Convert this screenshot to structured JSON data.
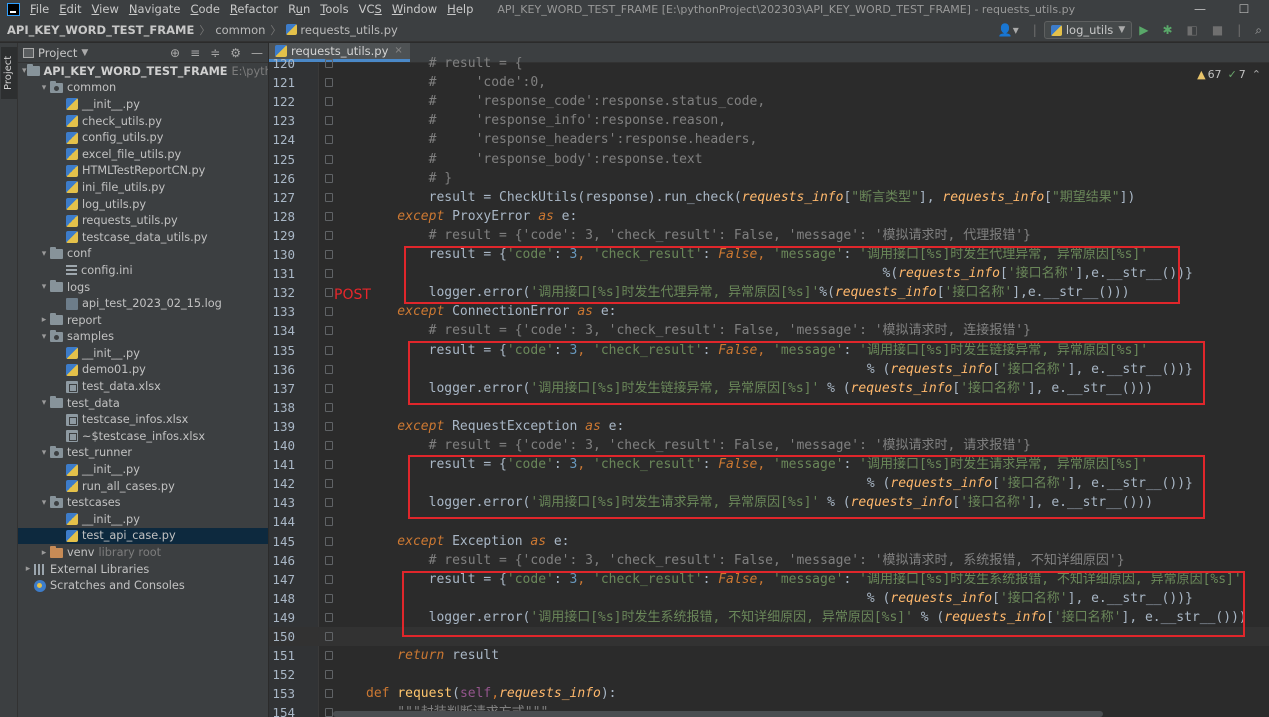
{
  "menu": {
    "items": [
      {
        "pre": "",
        "u": "F",
        "post": "ile"
      },
      {
        "pre": "",
        "u": "E",
        "post": "dit"
      },
      {
        "pre": "",
        "u": "V",
        "post": "iew"
      },
      {
        "pre": "",
        "u": "N",
        "post": "avigate"
      },
      {
        "pre": "",
        "u": "C",
        "post": "ode"
      },
      {
        "pre": "",
        "u": "R",
        "post": "efactor"
      },
      {
        "pre": "R",
        "u": "u",
        "post": "n"
      },
      {
        "pre": "",
        "u": "T",
        "post": "ools"
      },
      {
        "pre": "VC",
        "u": "S",
        "post": ""
      },
      {
        "pre": "",
        "u": "W",
        "post": "indow"
      },
      {
        "pre": "",
        "u": "H",
        "post": "elp"
      }
    ],
    "window_title": "API_KEY_WORD_TEST_FRAME [E:\\pythonProject\\202303\\API_KEY_WORD_TEST_FRAME] - requests_utils.py",
    "minimize": "—",
    "maximize": "☐"
  },
  "breadcrumb": {
    "project": "API_KEY_WORD_TEST_FRAME",
    "folder": "common",
    "file": "requests_utils.py"
  },
  "toolbar": {
    "user_icon": "person-icon",
    "run_config": "log_utils",
    "run": "▶",
    "debug": "✱",
    "coverage": "◧",
    "stop": "■",
    "search": "⌕"
  },
  "tool_strip": {
    "project_tab": "Project"
  },
  "project_panel": {
    "title": "Project",
    "tools": [
      "⊕",
      "≡",
      "≑",
      "⚙",
      "—"
    ],
    "tree": [
      {
        "depth": 0,
        "arrow": "▾",
        "icon": "folder",
        "label": "API_KEY_WORD_TEST_FRAME",
        "hint": "E:\\pythonPro",
        "bold": true
      },
      {
        "depth": 1,
        "arrow": "▾",
        "icon": "folder pkg",
        "label": "common"
      },
      {
        "depth": 2,
        "arrow": "",
        "icon": "py",
        "label": "__init__.py"
      },
      {
        "depth": 2,
        "arrow": "",
        "icon": "py",
        "label": "check_utils.py"
      },
      {
        "depth": 2,
        "arrow": "",
        "icon": "py",
        "label": "config_utils.py"
      },
      {
        "depth": 2,
        "arrow": "",
        "icon": "py",
        "label": "excel_file_utils.py"
      },
      {
        "depth": 2,
        "arrow": "",
        "icon": "py",
        "label": "HTMLTestReportCN.py"
      },
      {
        "depth": 2,
        "arrow": "",
        "icon": "py",
        "label": "ini_file_utils.py"
      },
      {
        "depth": 2,
        "arrow": "",
        "icon": "py",
        "label": "log_utils.py"
      },
      {
        "depth": 2,
        "arrow": "",
        "icon": "py",
        "label": "requests_utils.py"
      },
      {
        "depth": 2,
        "arrow": "",
        "icon": "py",
        "label": "testcase_data_utils.py"
      },
      {
        "depth": 1,
        "arrow": "▾",
        "icon": "folder",
        "label": "conf"
      },
      {
        "depth": 2,
        "arrow": "",
        "icon": "ini",
        "label": "config.ini"
      },
      {
        "depth": 1,
        "arrow": "▾",
        "icon": "folder",
        "label": "logs"
      },
      {
        "depth": 2,
        "arrow": "",
        "icon": "log",
        "label": "api_test_2023_02_15.log"
      },
      {
        "depth": 1,
        "arrow": "▸",
        "icon": "folder",
        "label": "report"
      },
      {
        "depth": 1,
        "arrow": "▾",
        "icon": "folder pkg",
        "label": "samples"
      },
      {
        "depth": 2,
        "arrow": "",
        "icon": "py",
        "label": "__init__.py"
      },
      {
        "depth": 2,
        "arrow": "",
        "icon": "py",
        "label": "demo01.py"
      },
      {
        "depth": 2,
        "arrow": "",
        "icon": "xlsx",
        "label": "test_data.xlsx"
      },
      {
        "depth": 1,
        "arrow": "▾",
        "icon": "folder",
        "label": "test_data"
      },
      {
        "depth": 2,
        "arrow": "",
        "icon": "xlsx",
        "label": "testcase_infos.xlsx"
      },
      {
        "depth": 2,
        "arrow": "",
        "icon": "xlsx",
        "label": "~$testcase_infos.xlsx"
      },
      {
        "depth": 1,
        "arrow": "▾",
        "icon": "folder pkg",
        "label": "test_runner"
      },
      {
        "depth": 2,
        "arrow": "",
        "icon": "py",
        "label": "__init__.py"
      },
      {
        "depth": 2,
        "arrow": "",
        "icon": "py",
        "label": "run_all_cases.py"
      },
      {
        "depth": 1,
        "arrow": "▾",
        "icon": "folder pkg",
        "label": "testcases"
      },
      {
        "depth": 2,
        "arrow": "",
        "icon": "py",
        "label": "__init__.py"
      },
      {
        "depth": 2,
        "arrow": "",
        "icon": "py",
        "label": "test_api_case.py",
        "selected": true
      },
      {
        "depth": 1,
        "arrow": "▸",
        "icon": "folder excluded",
        "label": "venv",
        "hint": "library root"
      },
      {
        "depth": 0,
        "arrow": "▸",
        "icon": "lib",
        "label": "External Libraries"
      },
      {
        "depth": 0,
        "arrow": "",
        "icon": "scratch",
        "label": "Scratches and Consoles"
      }
    ]
  },
  "editor": {
    "tab_label": "requests_utils.py",
    "tab_close": "×",
    "inspections": {
      "warnings": "67",
      "weak_warnings": "7"
    },
    "annotation": "POST",
    "current_line": 150
  },
  "code_lines": [
    {
      "n": "120",
      "parts": [
        [
          "cm",
          "        # result = {"
        ]
      ]
    },
    {
      "n": "121",
      "parts": [
        [
          "cm",
          "        #     'code':0,"
        ]
      ]
    },
    {
      "n": "122",
      "parts": [
        [
          "cm",
          "        #     'response_code':response.status_code,"
        ]
      ]
    },
    {
      "n": "123",
      "parts": [
        [
          "cm",
          "        #     'response_info':response.reason,"
        ]
      ]
    },
    {
      "n": "124",
      "parts": [
        [
          "cm",
          "        #     'response_headers':response.headers,"
        ]
      ]
    },
    {
      "n": "125",
      "parts": [
        [
          "cm",
          "        #     'response_body':response.text"
        ]
      ]
    },
    {
      "n": "126",
      "parts": [
        [
          "cm",
          "        # }"
        ]
      ]
    },
    {
      "n": "127",
      "parts": [
        [
          "",
          "        result = CheckUtils(response).run_check("
        ],
        [
          "pr",
          "requests_info"
        ],
        [
          "",
          "["
        ],
        [
          "str",
          "\"断言类型\""
        ],
        [
          "",
          "], "
        ],
        [
          "pr",
          "requests_info"
        ],
        [
          "",
          "["
        ],
        [
          "str",
          "\"期望结果\""
        ],
        [
          "",
          "])"
        ]
      ]
    },
    {
      "n": "128",
      "parts": [
        [
          "ki",
          "    except "
        ],
        [
          "",
          "ProxyError "
        ],
        [
          "ki",
          "as "
        ],
        [
          "",
          "e:"
        ]
      ]
    },
    {
      "n": "129",
      "parts": [
        [
          "cm",
          "        # result = {'code': 3, 'check_result': False, 'message': '模拟请求时, 代理报错'}"
        ]
      ]
    },
    {
      "n": "130",
      "parts": [
        [
          "",
          "        result = {"
        ],
        [
          "str",
          "'code'"
        ],
        [
          "",
          ": "
        ],
        [
          "num",
          "3"
        ],
        [
          "kw",
          ", "
        ],
        [
          "str",
          "'check_result'"
        ],
        [
          "",
          ": "
        ],
        [
          "ki",
          "False"
        ],
        [
          "kw",
          ", "
        ],
        [
          "str",
          "'message'"
        ],
        [
          "",
          ": "
        ],
        [
          "str",
          "'调用接口[%s]时发生代理异常, 异常原因[%s]'"
        ]
      ]
    },
    {
      "n": "131",
      "parts": [
        [
          "",
          "                                                                  %("
        ],
        [
          "pr",
          "requests_info"
        ],
        [
          "",
          "["
        ],
        [
          "str",
          "'接口名称'"
        ],
        [
          "",
          "],e.__str__())}"
        ]
      ]
    },
    {
      "n": "132",
      "parts": [
        [
          "",
          "        logger.error("
        ],
        [
          "str",
          "'调用接口[%s]时发生代理异常, 异常原因[%s]'"
        ],
        [
          "",
          "%("
        ],
        [
          "pr",
          "requests_info"
        ],
        [
          "",
          "["
        ],
        [
          "str",
          "'接口名称'"
        ],
        [
          "",
          "],e.__str__()))"
        ]
      ]
    },
    {
      "n": "133",
      "parts": [
        [
          "ki",
          "    except "
        ],
        [
          "",
          "ConnectionError "
        ],
        [
          "ki",
          "as "
        ],
        [
          "",
          "e:"
        ]
      ]
    },
    {
      "n": "134",
      "parts": [
        [
          "cm",
          "        # result = {'code': 3, 'check_result': False, 'message': '模拟请求时, 连接报错'}"
        ]
      ]
    },
    {
      "n": "135",
      "parts": [
        [
          "",
          "        result = {"
        ],
        [
          "str",
          "'code'"
        ],
        [
          "",
          ": "
        ],
        [
          "num",
          "3"
        ],
        [
          "kw",
          ", "
        ],
        [
          "str",
          "'check_result'"
        ],
        [
          "",
          ": "
        ],
        [
          "ki",
          "False"
        ],
        [
          "kw",
          ", "
        ],
        [
          "str",
          "'message'"
        ],
        [
          "",
          ": "
        ],
        [
          "str",
          "'调用接口[%s]时发生链接异常, 异常原因[%s]'"
        ]
      ]
    },
    {
      "n": "136",
      "parts": [
        [
          "",
          "                                                                % ("
        ],
        [
          "pr",
          "requests_info"
        ],
        [
          "",
          "["
        ],
        [
          "str",
          "'接口名称'"
        ],
        [
          "",
          "], e.__str__())}"
        ]
      ]
    },
    {
      "n": "137",
      "parts": [
        [
          "",
          "        logger.error("
        ],
        [
          "str",
          "'调用接口[%s]时发生链接异常, 异常原因[%s]'"
        ],
        [
          "",
          " % ("
        ],
        [
          "pr",
          "requests_info"
        ],
        [
          "",
          "["
        ],
        [
          "str",
          "'接口名称'"
        ],
        [
          "",
          "], e.__str__()))"
        ]
      ]
    },
    {
      "n": "138",
      "parts": [
        [
          "",
          ""
        ]
      ]
    },
    {
      "n": "139",
      "parts": [
        [
          "ki",
          "    except "
        ],
        [
          "",
          "RequestException "
        ],
        [
          "ki",
          "as "
        ],
        [
          "",
          "e:"
        ]
      ]
    },
    {
      "n": "140",
      "parts": [
        [
          "cm",
          "        # result = {'code': 3, 'check_result': False, 'message': '模拟请求时, 请求报错'}"
        ]
      ]
    },
    {
      "n": "141",
      "parts": [
        [
          "",
          "        result = {"
        ],
        [
          "str",
          "'code'"
        ],
        [
          "",
          ": "
        ],
        [
          "num",
          "3"
        ],
        [
          "kw",
          ", "
        ],
        [
          "str",
          "'check_result'"
        ],
        [
          "",
          ": "
        ],
        [
          "ki",
          "False"
        ],
        [
          "kw",
          ", "
        ],
        [
          "str",
          "'message'"
        ],
        [
          "",
          ": "
        ],
        [
          "str",
          "'调用接口[%s]时发生请求异常, 异常原因[%s]'"
        ]
      ]
    },
    {
      "n": "142",
      "parts": [
        [
          "",
          "                                                                % ("
        ],
        [
          "pr",
          "requests_info"
        ],
        [
          "",
          "["
        ],
        [
          "str",
          "'接口名称'"
        ],
        [
          "",
          "], e.__str__())}"
        ]
      ]
    },
    {
      "n": "143",
      "parts": [
        [
          "",
          "        logger.error("
        ],
        [
          "str",
          "'调用接口[%s]时发生请求异常, 异常原因[%s]'"
        ],
        [
          "",
          " % ("
        ],
        [
          "pr",
          "requests_info"
        ],
        [
          "",
          "["
        ],
        [
          "str",
          "'接口名称'"
        ],
        [
          "",
          "], e.__str__()))"
        ]
      ]
    },
    {
      "n": "144",
      "parts": [
        [
          "",
          ""
        ]
      ]
    },
    {
      "n": "145",
      "parts": [
        [
          "ki",
          "    except "
        ],
        [
          "",
          "Exception "
        ],
        [
          "ki",
          "as "
        ],
        [
          "",
          "e:"
        ]
      ]
    },
    {
      "n": "146",
      "parts": [
        [
          "cm",
          "        # result = {'code': 3, 'check_result': False, 'message': '模拟请求时, 系统报错, 不知详细原因'}"
        ]
      ]
    },
    {
      "n": "147",
      "parts": [
        [
          "",
          "        result = {"
        ],
        [
          "str",
          "'code'"
        ],
        [
          "",
          ": "
        ],
        [
          "num",
          "3"
        ],
        [
          "kw",
          ", "
        ],
        [
          "str",
          "'check_result'"
        ],
        [
          "",
          ": "
        ],
        [
          "ki",
          "False"
        ],
        [
          "kw",
          ", "
        ],
        [
          "str",
          "'message'"
        ],
        [
          "",
          ": "
        ],
        [
          "str",
          "'调用接口[%s]时发生系统报错, 不知详细原因, 异常原因[%s]'"
        ]
      ]
    },
    {
      "n": "148",
      "parts": [
        [
          "",
          "                                                                % ("
        ],
        [
          "pr",
          "requests_info"
        ],
        [
          "",
          "["
        ],
        [
          "str",
          "'接口名称'"
        ],
        [
          "",
          "], e.__str__())}"
        ]
      ]
    },
    {
      "n": "149",
      "parts": [
        [
          "",
          "        logger.error("
        ],
        [
          "str",
          "'调用接口[%s]时发生系统报错, 不知详细原因, 异常原因[%s]'"
        ],
        [
          "",
          " % ("
        ],
        [
          "pr",
          "requests_info"
        ],
        [
          "",
          "["
        ],
        [
          "str",
          "'接口名称'"
        ],
        [
          "",
          "], e.__str__()))"
        ]
      ]
    },
    {
      "n": "150",
      "parts": [
        [
          "",
          ""
        ]
      ]
    },
    {
      "n": "151",
      "parts": [
        [
          "ki",
          "    return "
        ],
        [
          "",
          "result"
        ]
      ]
    },
    {
      "n": "152",
      "parts": [
        [
          "",
          ""
        ]
      ]
    },
    {
      "n": "153",
      "parts": [
        [
          "kw",
          "def "
        ],
        [
          "fn",
          "request"
        ],
        [
          "",
          "("
        ],
        [
          "self",
          "self"
        ],
        [
          "kw",
          ","
        ],
        [
          "pr",
          "requests_info"
        ],
        [
          "",
          "):"
        ]
      ]
    },
    {
      "n": "154",
      "parts": [
        [
          "cm",
          "    \"\"\"封装判断请求方式\"\"\""
        ]
      ]
    }
  ]
}
